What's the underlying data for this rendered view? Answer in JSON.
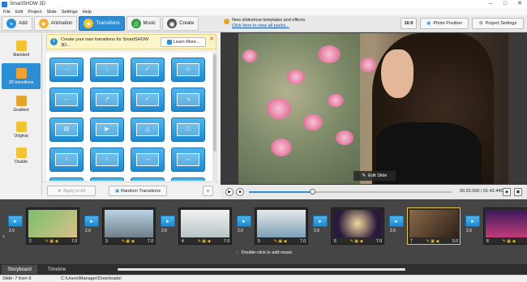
{
  "window": {
    "title": "SmartSHOW 3D",
    "minimize": "–",
    "maximize": "□",
    "close": "✕"
  },
  "menu": [
    "File",
    "Edit",
    "Project",
    "Slide",
    "Settings",
    "Help"
  ],
  "toolbar": {
    "tabs": [
      {
        "label": "Add",
        "icon": "add-icon"
      },
      {
        "label": "Animation",
        "icon": "animation-icon"
      },
      {
        "label": "Transitions",
        "icon": "star-icon",
        "active": true
      },
      {
        "label": "Music",
        "icon": "music-icon"
      },
      {
        "label": "Create",
        "icon": "film-icon"
      }
    ]
  },
  "left_nav": [
    {
      "label": "Standard"
    },
    {
      "label": "3D transitions",
      "active": true
    },
    {
      "label": "Gradient"
    },
    {
      "label": "Original"
    },
    {
      "label": "Double"
    }
  ],
  "tip": {
    "text": "Create your own transitions for SmartSHOW 3D...",
    "learn_more": "Learn More..."
  },
  "transition_grid": {
    "rows": 5,
    "cols": 4
  },
  "panel_buttons": {
    "apply_all": "Apply to All",
    "random": "Random Transitions"
  },
  "right_bar": {
    "news_line1": "New slideshow templates and effects",
    "news_line2": "Click here to view all packs...",
    "aspect": "16:9",
    "photo_position": "Photo Position",
    "project_settings": "Project Settings"
  },
  "preview": {
    "edit_slide": "Edit Slide"
  },
  "player": {
    "time": "00:32.000 / 01:42.440",
    "progress": 0.31
  },
  "storyboard": {
    "slides": [
      {
        "num": "2",
        "duration": "7.0"
      },
      {
        "num": "3",
        "duration": "7.0"
      },
      {
        "num": "4",
        "duration": "7.0"
      },
      {
        "num": "5",
        "duration": "7.0"
      },
      {
        "num": "6",
        "duration": "7.0"
      },
      {
        "num": "7",
        "duration": "5.0",
        "selected": true
      },
      {
        "num": "8",
        "duration": "7.0"
      }
    ],
    "transitions": [
      "2.0",
      "2.0",
      "2.0",
      "2.0",
      "2.0",
      "2.0",
      "2.0"
    ],
    "music_hint": "Double-click to add music"
  },
  "bottom_tabs": [
    {
      "label": "Storyboard",
      "active": true
    },
    {
      "label": "Timeline"
    }
  ],
  "status": {
    "slide": "Slide: 7 from 9",
    "path": "C:\\Users\\Manager\\Downloads\\"
  },
  "colors": {
    "accent": "#2c8fd6",
    "tile": "#2a95dc",
    "storyboard_bg": "#454545",
    "selected": "#e8c83a"
  }
}
